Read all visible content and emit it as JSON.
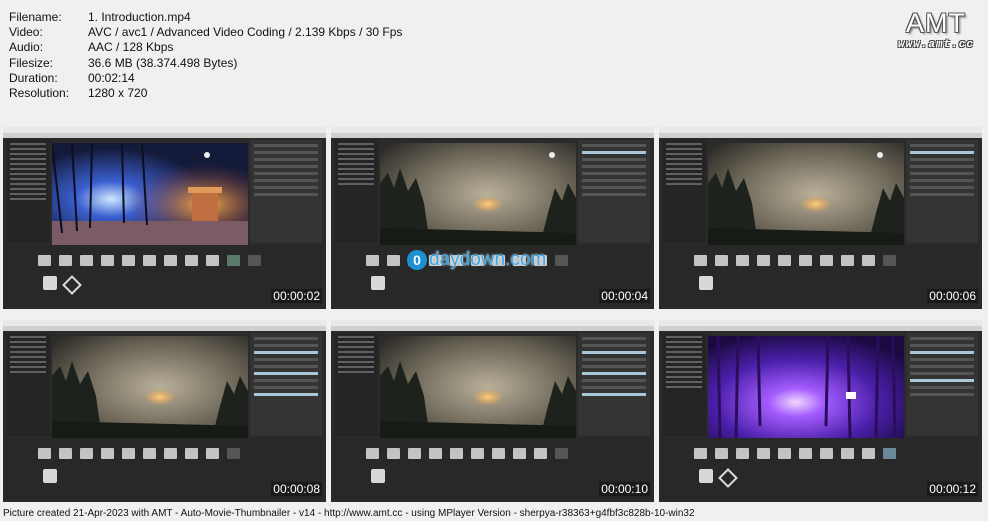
{
  "info": [
    {
      "key": "Filename:",
      "value": "1. Introduction.mp4"
    },
    {
      "key": "Video:",
      "value": "AVC / avc1 / Advanced Video Coding / 2.139 Kbps / 30 Fps"
    },
    {
      "key": "Audio:",
      "value": "AAC / 128 Kbps"
    },
    {
      "key": "Filesize:",
      "value": "36.6 MB (38.374.498 Bytes)"
    },
    {
      "key": "Duration:",
      "value": "00:02:14"
    },
    {
      "key": "Resolution:",
      "value": "1280 x 720"
    }
  ],
  "logo": {
    "text": "AMT",
    "url": "www.amt.cc"
  },
  "watermark": {
    "mark": "0",
    "text": "daydown.com"
  },
  "thumbnails": [
    {
      "timestamp": "00:00:02",
      "scene": "night-ruin"
    },
    {
      "timestamp": "00:00:04",
      "scene": "forest-mist"
    },
    {
      "timestamp": "00:00:06",
      "scene": "forest-mist"
    },
    {
      "timestamp": "00:00:08",
      "scene": "forest-mist"
    },
    {
      "timestamp": "00:00:10",
      "scene": "forest-mist"
    },
    {
      "timestamp": "00:00:12",
      "scene": "purple-forest"
    }
  ],
  "footer": "Picture created 21-Apr-2023 with AMT - Auto-Movie-Thumbnailer - v14 - http://www.amt.cc - using MPlayer Version - sherpya-r38363+g4fbf3c828b-10-win32"
}
